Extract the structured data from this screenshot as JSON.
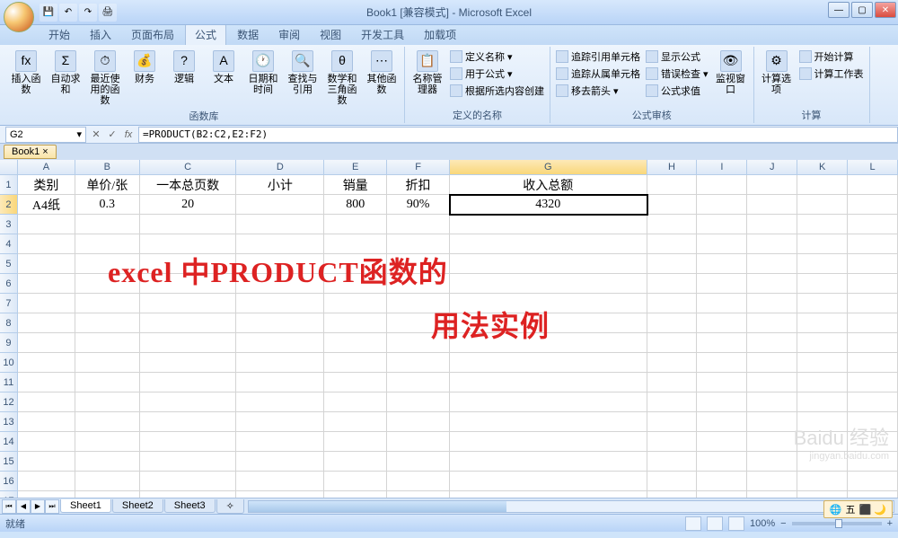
{
  "title": "Book1 [兼容模式] - Microsoft Excel",
  "qat": [
    "💾",
    "↶",
    "↷",
    "🖨"
  ],
  "tabs": [
    "开始",
    "插入",
    "页面布局",
    "公式",
    "数据",
    "审阅",
    "视图",
    "开发工具",
    "加载项"
  ],
  "active_tab": "公式",
  "ribbon": {
    "g1": {
      "label": "函数库",
      "items": [
        "插入函数",
        "自动求和",
        "最近使用的函数",
        "财务",
        "逻辑",
        "文本",
        "日期和时间",
        "查找与引用",
        "数学和三角函数",
        "其他函数"
      ],
      "fx": "fx",
      "sigma": "Σ"
    },
    "g2": {
      "label": "定义的名称",
      "big": "名称管理器",
      "items": [
        "定义名称",
        "用于公式",
        "根据所选内容创建"
      ]
    },
    "g3": {
      "label": "公式审核",
      "items": [
        "追踪引用单元格",
        "追踪从属单元格",
        "移去箭头",
        "显示公式",
        "错误检查",
        "公式求值"
      ],
      "big": "监视窗口"
    },
    "g4": {
      "label": "计算",
      "big": "计算选项",
      "items": [
        "开始计算",
        "计算工作表"
      ]
    }
  },
  "namebox": "G2",
  "formula": "=PRODUCT(B2:C2,E2:F2)",
  "wbtab": "Book1",
  "columns": [
    "A",
    "B",
    "C",
    "D",
    "E",
    "F",
    "G",
    "H",
    "I",
    "J",
    "K",
    "L"
  ],
  "headers": [
    "类别",
    "单价/张",
    "一本总页数",
    "小计",
    "销量",
    "折扣",
    "收入总额"
  ],
  "datarow": [
    "A4纸",
    "0.3",
    "20",
    "",
    "800",
    "90%",
    "4320"
  ],
  "selected_col": "G",
  "selected_row": 2,
  "overlay1": "excel 中PRODUCT函数的",
  "overlay2": "用法实例",
  "sheets": [
    "Sheet1",
    "Sheet2",
    "Sheet3"
  ],
  "status": "就绪",
  "zoom": "100%",
  "lang_indicator": "五",
  "watermark": "Baidu 经验",
  "watermark_sub": "jingyan.baidu.com"
}
